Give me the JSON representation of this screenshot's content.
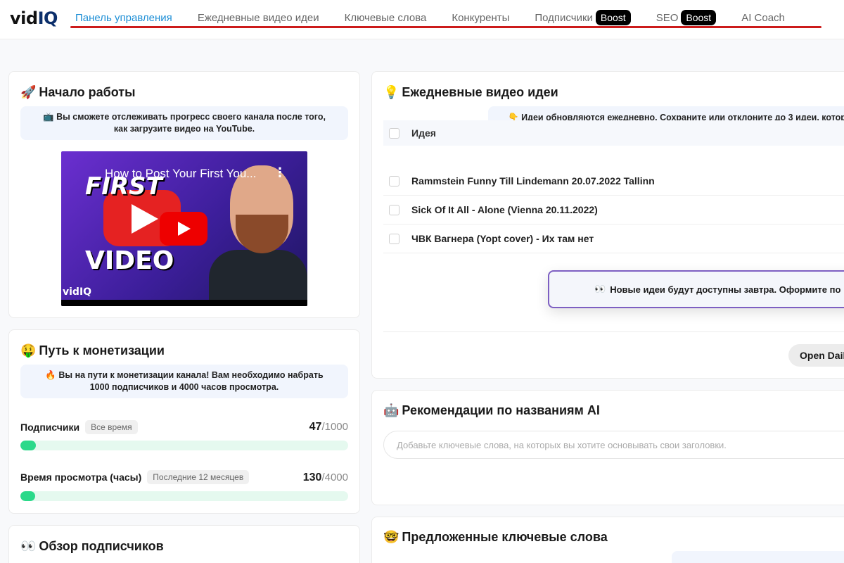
{
  "header": {
    "logo_text": "vid",
    "logo_accent": "IQ",
    "nav": [
      {
        "label": "Панель управления",
        "active": true
      },
      {
        "label": "Ежедневные видео идеи"
      },
      {
        "label": "Ключевые слова"
      },
      {
        "label": "Конкуренты"
      },
      {
        "label": "Подписчики",
        "badge": "Boost"
      },
      {
        "label": "SEO",
        "badge": "Boost"
      },
      {
        "label": "AI Coach"
      }
    ]
  },
  "getting_started": {
    "icon": "rocket-icon",
    "emoji": "🚀",
    "title": "Начало работы",
    "info_emoji": "📺",
    "info_line1": "Вы сможете отслеживать прогресс своего канала после того,",
    "info_line2": "как загрузите видео на YouTube.",
    "video_title": "How to Post Your First You...",
    "video_word1": "FIRST",
    "video_word2": "VIDEO",
    "video_logo": "vidIQ"
  },
  "monetization": {
    "icon": "money-face-icon",
    "emoji": "🤑",
    "title": "Путь к монетизации",
    "info_emoji": "🔥",
    "info_line1": "Вы на пути к монетизации канала! Вам необходимо набрать",
    "info_line2": "1000 подписчиков и 4000 часов просмотра.",
    "subscribers": {
      "label": "Подписчики",
      "period": "Все время",
      "value": "47",
      "total": "/1000",
      "progress": 0.047
    },
    "watch_time": {
      "label": "Время просмотра (часы)",
      "period": "Последние 12 месяцев",
      "value": "130",
      "total": "/4000",
      "progress": 0.0325
    }
  },
  "subscribers_overview": {
    "icon": "eyes-icon",
    "emoji": "👀",
    "title": "Обзор подписчиков"
  },
  "daily_ideas": {
    "icon": "lightbulb-icon",
    "emoji": "💡",
    "title": "Ежедневные видео идеи",
    "info_emoji": "👇",
    "info_text": "Идеи обновляются ежедневно. Сохраните или отклоните до 3 идеи, которы",
    "column_header": "Идея",
    "rows": [
      "Rammstein Funny Till Lindemann 20.07.2022 Tallinn",
      "Sick Of It All - Alone (Vienna 20.11.2022)",
      "ЧВК Вагнера (Yopt cover) - Их там нет"
    ],
    "promo_emoji": "👀",
    "promo_text": "Новые идеи будут доступны завтра. Оформите по",
    "open_button": "Open Dail"
  },
  "ai_titles": {
    "icon": "robot-icon",
    "emoji": "🤖",
    "title": "Рекомендации по названиям AI",
    "input_placeholder": "Добавьте ключевые слова, на которых вы хотите основывать свои заголовки."
  },
  "suggested_keywords": {
    "icon": "nerd-face-icon",
    "emoji": "🤓",
    "title": "Предложенные ключевые слова"
  }
}
